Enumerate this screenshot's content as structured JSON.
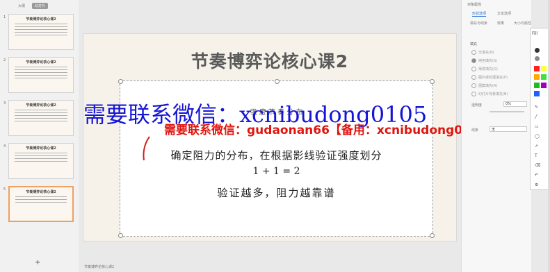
{
  "left_panel": {
    "tabs": [
      "大纲",
      "幻灯片"
    ],
    "slides": [
      {
        "num": "1",
        "title": "节奏博弈论核心课2"
      },
      {
        "num": "2",
        "title": "节奏博弈论核心课2"
      },
      {
        "num": "3",
        "title": "节奏博弈论核心课2"
      },
      {
        "num": "4",
        "title": "节奏博弈论核心课2"
      },
      {
        "num": "5",
        "title": "节奏博弈论核心课2"
      }
    ],
    "add_label": "+"
  },
  "slide": {
    "title": "节奏博弈论核心课2",
    "handwriting_top": "强 度 节 奏 分 布",
    "line1": "确定阻力的分布，在根据影线验证强度划分",
    "line2": "1 + 1 = 2",
    "line3": "验证越多，阻力越靠谱"
  },
  "watermarks": {
    "big": "需要联系微信：xcnibudong0105",
    "small": "需要联系微信：gudaonan66【备用：xcnibudong0105】"
  },
  "status": {
    "text": "节奏博弈论核心课2"
  },
  "right_pane": {
    "title": "对象属性",
    "tabs": [
      "形状选项",
      "文本选项"
    ],
    "icon_labels": [
      "填充与线条",
      "效果",
      "大小与属性"
    ],
    "section": "填充",
    "options": [
      "无填充(N)",
      "纯色填充(S)",
      "渐变填充(G)",
      "图片或纹理填充(P)",
      "图案填充(A)",
      "幻灯片背景填充(B)"
    ],
    "transparency_label": "透明度",
    "transparency_value": "0%",
    "line_label": "线条",
    "line_value": "无"
  },
  "palette": {
    "colors": [
      "#333333",
      "#888888",
      "#bbbbbb",
      "#ff2020",
      "#ffaa00",
      "#20bb20",
      "#2060ff",
      "#a000c0"
    ],
    "label_fill": "Fill",
    "label_pen": "笔"
  }
}
